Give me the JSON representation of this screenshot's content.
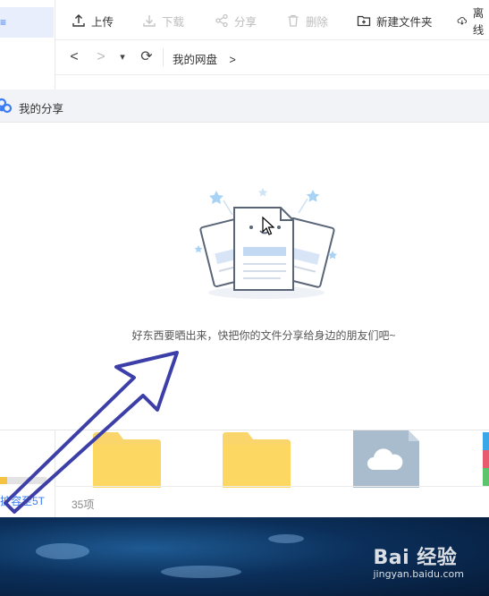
{
  "sidebar": {
    "active_item": "≡"
  },
  "toolbar": {
    "upload": "上传",
    "download": "下载",
    "share": "分享",
    "delete": "删除",
    "new_folder": "新建文件夹",
    "offline": "离线"
  },
  "nav": {
    "back": "<",
    "forward": ">",
    "history": "▾",
    "refresh": "⟳",
    "breadcrumb": "我的网盘",
    "breadcrumb_sep": ">"
  },
  "share_panel": {
    "title": "我的分享",
    "empty_message": "好东西要晒出来，快把你的文件分享给身边的朋友们吧~"
  },
  "bottom": {
    "expand_link": "扩容至5T",
    "item_count": "35项",
    "storage_used_fraction": 0.15
  },
  "watermark": {
    "logo": "Bai 经验",
    "sub": "jingyan.baidu.com"
  },
  "colors": {
    "accent": "#3b7cf5",
    "arrow": "#3d3fa8",
    "folder": "#f9d56b",
    "panel_header": "#f1f3f7"
  }
}
